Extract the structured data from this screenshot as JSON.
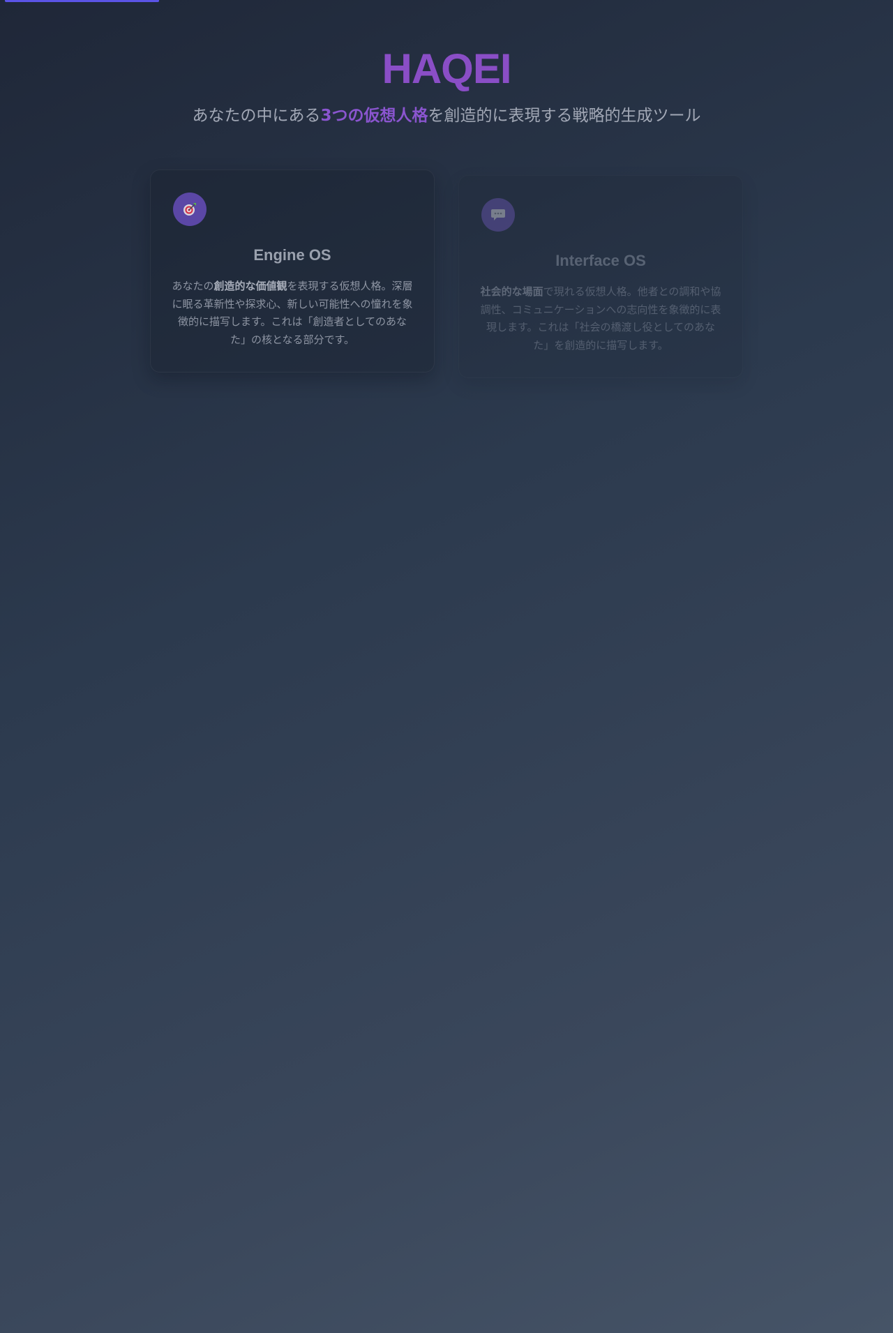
{
  "hero": {
    "title": "HAQEI",
    "subtitle_before": "あなたの中にある",
    "subtitle_highlight": "3つの仮想人格",
    "subtitle_after": "を創造的に表現する戦略的生成ツール"
  },
  "cards": [
    {
      "icon": "target-icon",
      "title": "Engine OS",
      "desc_before": "あなたの",
      "desc_strong": "創造的な価値観",
      "desc_after": "を表現する仮想人格。深層に眠る革新性や探求心、新しい可能性への憧れを象徴的に描写します。これは「創造者としてのあなた」の核となる部分です。"
    },
    {
      "icon": "speech-bubble-icon",
      "title": "Interface OS",
      "desc_before": "",
      "desc_strong": "社会的な場面",
      "desc_after": "で現れる仮想人格。他者との調和や協調性、コミュニケーションへの志向性を象徴的に表現します。これは「社会の橋渡し役としてのあなた」を創造的に描写します。"
    }
  ],
  "colors": {
    "accent": "#8a4ec6",
    "progress": "#5b54e6",
    "background_start": "#1f2738",
    "background_end": "#465467"
  }
}
